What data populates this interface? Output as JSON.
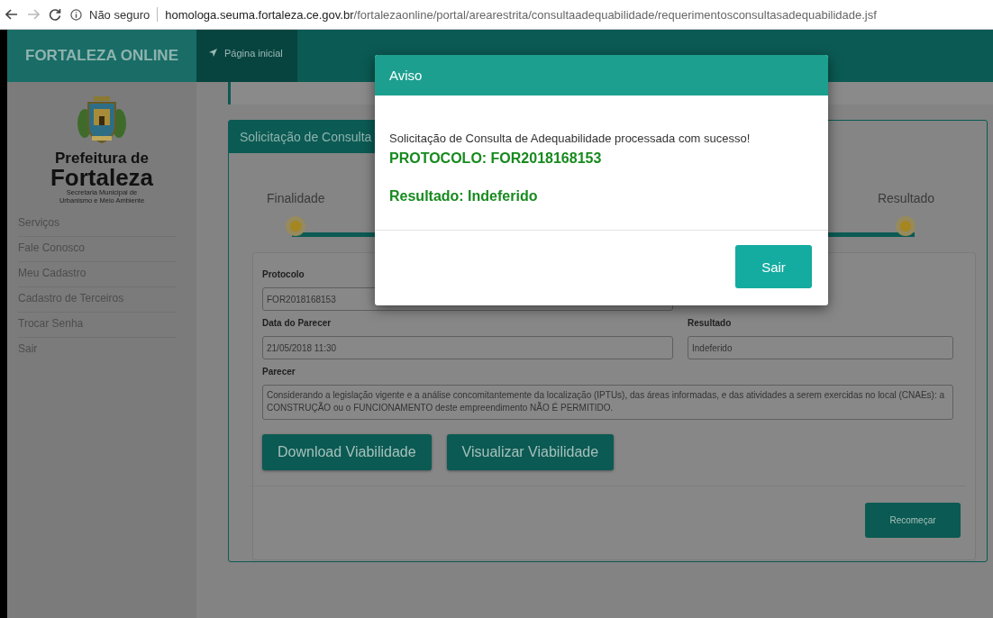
{
  "browser": {
    "security": "Não seguro",
    "url_host": "homologa.seuma.fortaleza.ce.gov.br",
    "url_path": "/fortalezaonline/portal/arearestrita/consultaadequabilidade/requerimentosconsultasadequabilidade.jsf"
  },
  "header": {
    "brand": "FORTALEZA ONLINE",
    "nav": [
      {
        "label": "Página inicial",
        "selected": true
      }
    ]
  },
  "sidebar": {
    "logo": {
      "line_1": "Prefeitura de",
      "line_2": "Fortaleza",
      "subtitle_1": "Secretaria Municipal de",
      "subtitle_2": "Urbanismo e Meio Ambiente"
    },
    "items": [
      {
        "label": "Serviços"
      },
      {
        "label": "Fale Conosco"
      },
      {
        "label": "Meu Cadastro"
      },
      {
        "label": "Cadastro de Terceiros"
      },
      {
        "label": "Trocar Senha"
      },
      {
        "label": "Sair"
      }
    ]
  },
  "card": {
    "title": "Solicitação de Consulta",
    "steps": [
      {
        "label": "Finalidade"
      },
      {
        "label": "Resultado"
      }
    ],
    "rows": [
      [
        {
          "label": "Protocolo",
          "value": "FOR2018168153"
        }
      ],
      [
        {
          "label": "Data do Parecer",
          "value": "21/05/2018 11:30"
        },
        {
          "label": "Resultado",
          "value": "Indeferido"
        }
      ]
    ],
    "parecer": {
      "label": "Parecer",
      "value": "Considerando a legislação vigente e a análise concomitantemente da localização (IPTUs), das áreas informadas, e das atividades a serem exercidas no local (CNAEs): a CONSTRUÇÃO ou o FUNCIONAMENTO deste empreendimento NÃO É PERMITIDO."
    },
    "buttons": [
      "Download Viabilidade",
      "Visualizar Viabilidade"
    ],
    "restart": "Recomeçar"
  },
  "modal": {
    "title": "Aviso",
    "message": "Solicitação de Consulta de Adequabilidade processada com sucesso!",
    "protocol": "PROTOCOLO: FOR2018168153",
    "result": "Resultado: Indeferido",
    "button": "Sair"
  }
}
